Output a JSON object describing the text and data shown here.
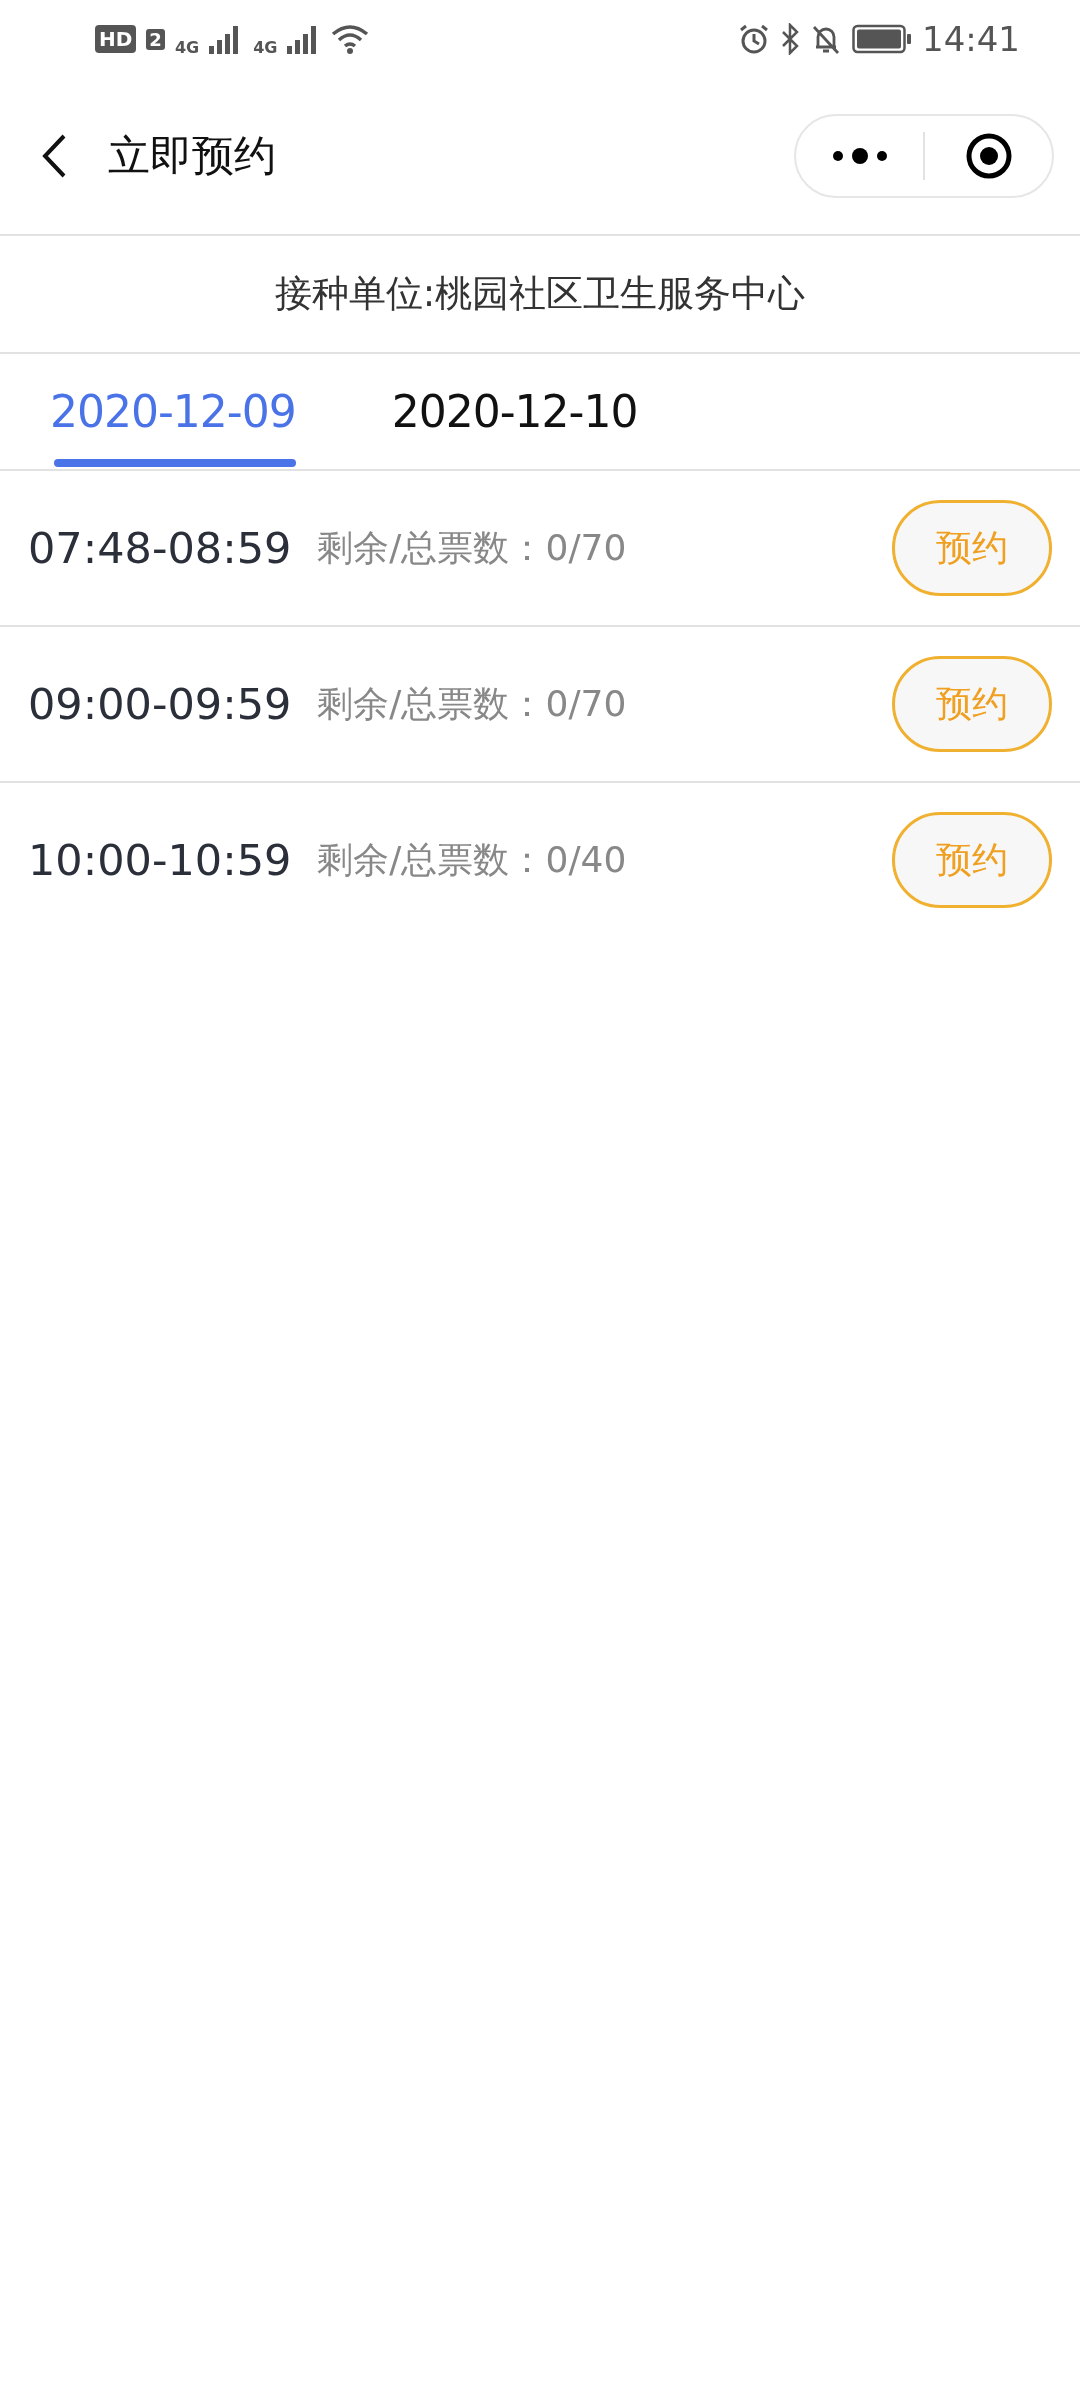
{
  "status_bar": {
    "hd": "HD",
    "sim": "2",
    "networks": [
      "4G",
      "4G"
    ],
    "time": "14:41"
  },
  "nav": {
    "title": "立即预约"
  },
  "unit": "接种单位:桃园社区卫生服务中心",
  "tabs": [
    {
      "label": "2020-12-09",
      "selected": true
    },
    {
      "label": "2020-12-10",
      "selected": false
    }
  ],
  "slots": [
    {
      "time": "07:48-08:59",
      "remaining": "剩余/总票数：0/70",
      "button": "预约"
    },
    {
      "time": "09:00-09:59",
      "remaining": "剩余/总票数：0/70",
      "button": "预约"
    },
    {
      "time": "10:00-10:59",
      "remaining": "剩余/总票数：0/40",
      "button": "预约"
    }
  ]
}
